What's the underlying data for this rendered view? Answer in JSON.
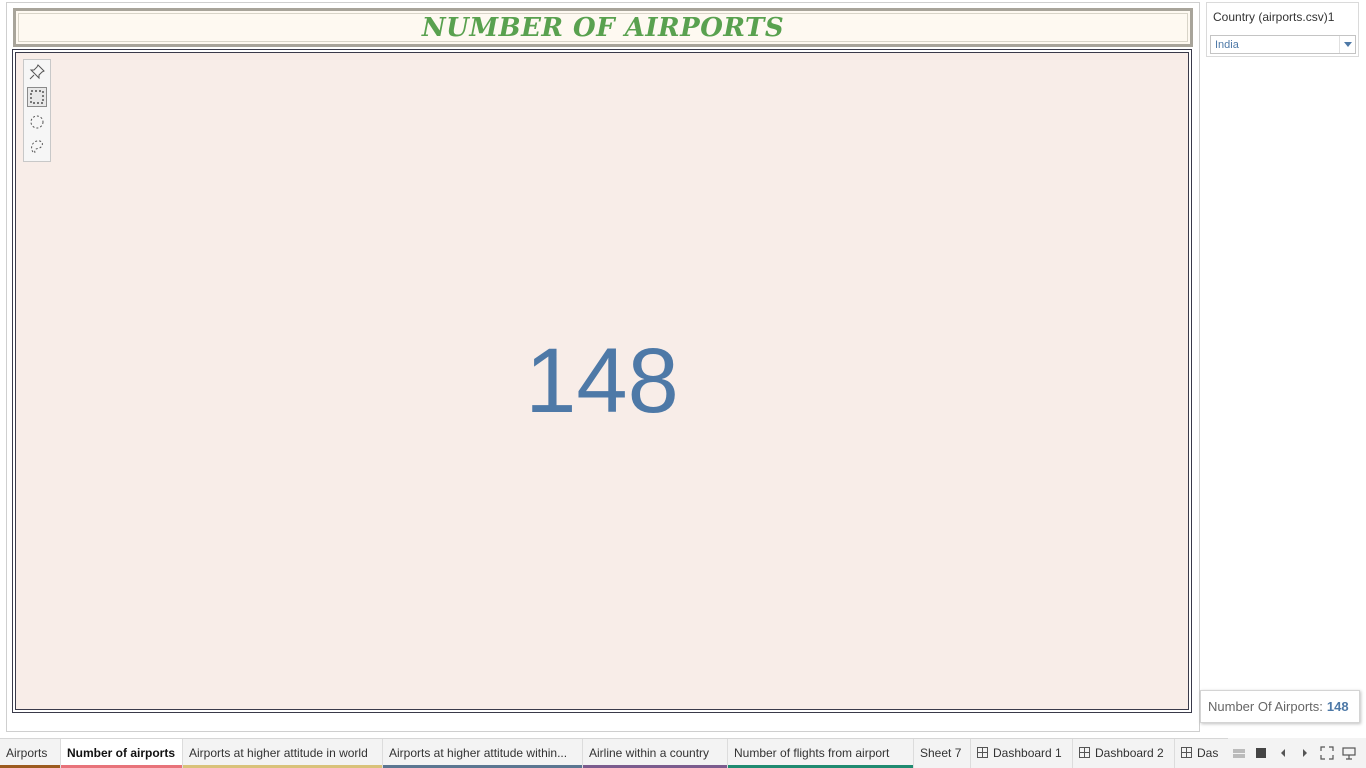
{
  "title": "NUMBER OF AIRPORTS",
  "kpi": {
    "value": "148"
  },
  "filter": {
    "title": "Country (airports.csv)1",
    "selected": "India"
  },
  "tooltip": {
    "label": "Number Of Airports:",
    "value": "148"
  },
  "toolbar": {
    "tools": [
      "pin-icon",
      "rectangle-select-icon",
      "radial-select-icon",
      "lasso-select-icon"
    ],
    "active": "rectangle-select-icon"
  },
  "tabs": [
    {
      "label": "Airports",
      "color": "#9c5b1f",
      "type": "sheet"
    },
    {
      "label": "Number of airports",
      "color": "#e8737a",
      "type": "sheet",
      "active": true
    },
    {
      "label": "Airports at higher attitude in world",
      "color": "#d9c27a",
      "type": "sheet"
    },
    {
      "label": "Airports at higher attitude within...",
      "color": "#5b7691",
      "type": "sheet"
    },
    {
      "label": "Airline within a country",
      "color": "#7b5c8e",
      "type": "sheet"
    },
    {
      "label": "Number of flights from airport",
      "color": "#1f8a70",
      "type": "sheet"
    },
    {
      "label": "Sheet 7",
      "color": "",
      "type": "sheet"
    },
    {
      "label": "Dashboard 1",
      "color": "",
      "type": "dashboard"
    },
    {
      "label": "Dashboard 2",
      "color": "",
      "type": "dashboard"
    },
    {
      "label": "Das",
      "color": "",
      "type": "dashboard"
    }
  ],
  "colors": {
    "title": "#59a14f",
    "kpi": "#4e79a7",
    "viz_background": "#f8ede8",
    "title_background": "#fef9f1"
  }
}
